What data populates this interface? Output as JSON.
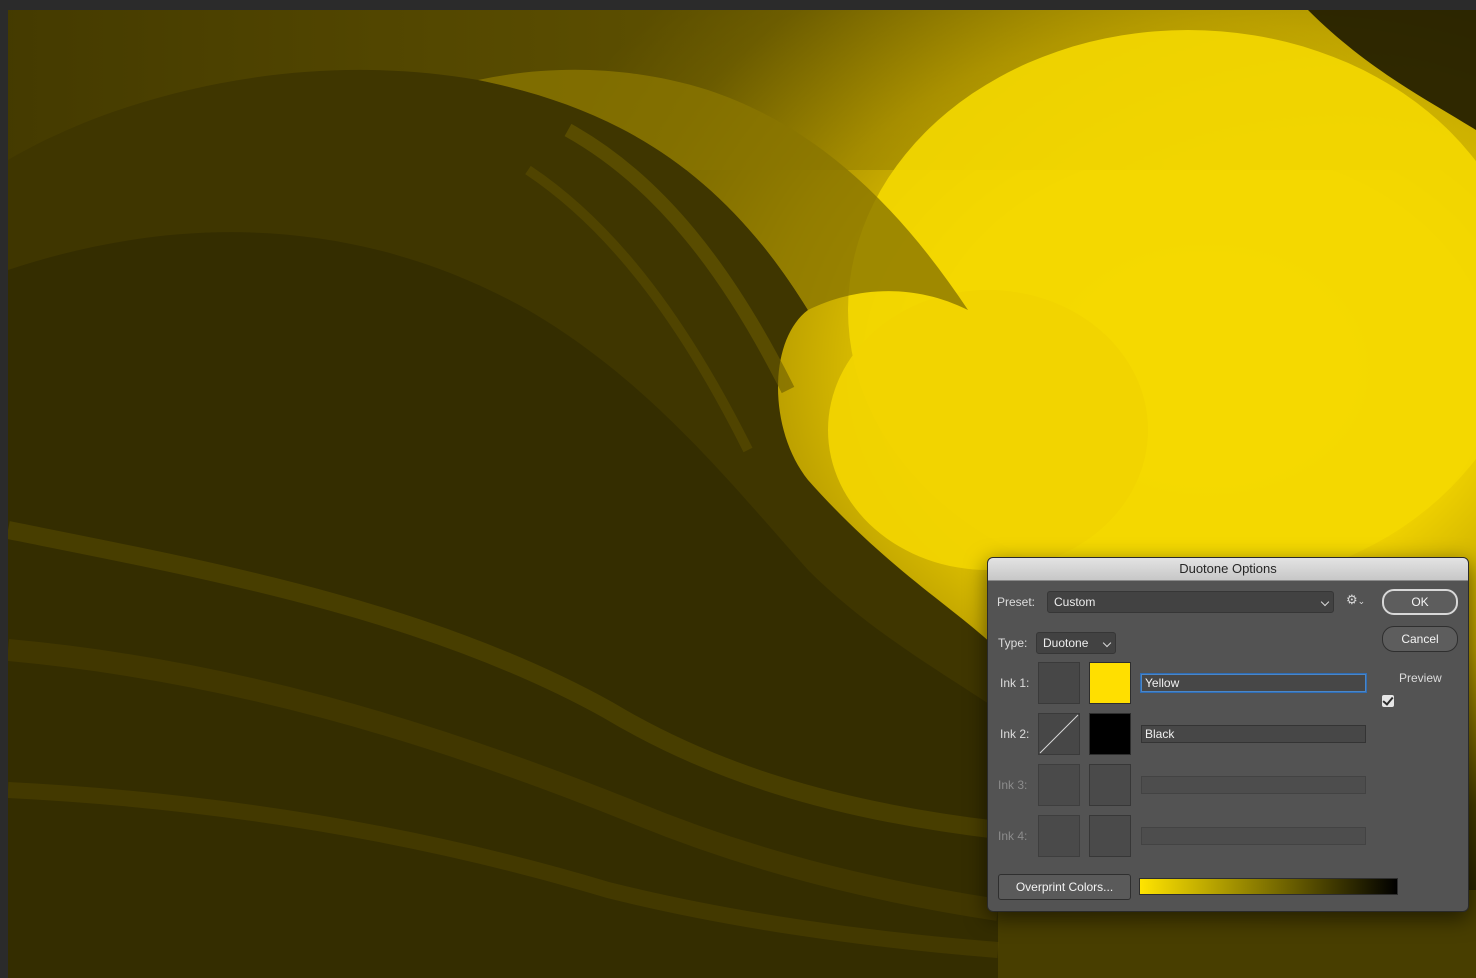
{
  "dialog": {
    "title": "Duotone Options",
    "preset_label": "Preset:",
    "preset_value": "Custom",
    "type_label": "Type:",
    "type_value": "Duotone",
    "ok_label": "OK",
    "cancel_label": "Cancel",
    "preview_label": "Preview",
    "preview_checked": true,
    "overprint_label": "Overprint Colors...",
    "inks": [
      {
        "label": "Ink 1:",
        "name": "Yellow",
        "color": "#ffdf00",
        "enabled": true
      },
      {
        "label": "Ink 2:",
        "name": "Black",
        "color": "#000000",
        "enabled": true
      },
      {
        "label": "Ink 3:",
        "name": "",
        "color": "",
        "enabled": false
      },
      {
        "label": "Ink 4:",
        "name": "",
        "color": "",
        "enabled": false
      }
    ],
    "ramp_colors": [
      "#ffe400",
      "#000000"
    ]
  },
  "canvas": {
    "accent_light": "#ffe205",
    "accent_dark": "#2a2400"
  }
}
